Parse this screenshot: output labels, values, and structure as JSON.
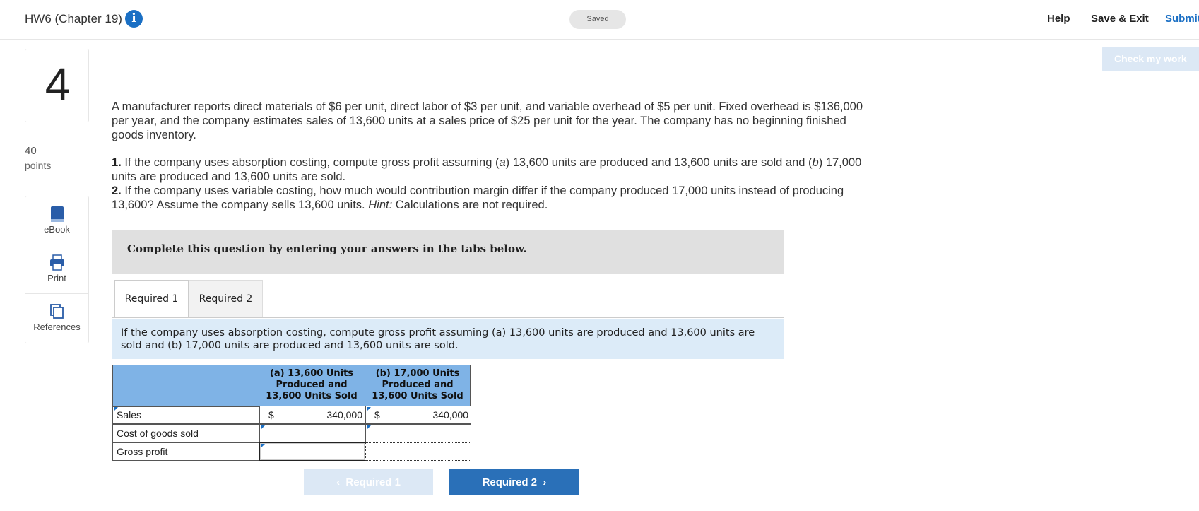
{
  "header": {
    "title": "HW6 (Chapter 19)",
    "status": "Saved",
    "help_label": "Help",
    "save_exit_label": "Save & Exit",
    "submit_label": "Submit"
  },
  "check_work_label": "Check my work",
  "question": {
    "number": "4",
    "points_value": "40",
    "points_label": "points"
  },
  "tools": [
    {
      "label": "eBook",
      "icon": "book-icon"
    },
    {
      "label": "Print",
      "icon": "printer-icon"
    },
    {
      "label": "References",
      "icon": "references-icon"
    }
  ],
  "body": {
    "intro": "A manufacturer reports direct materials of $6 per unit, direct labor of $3 per unit, and variable overhead of $5 per unit. Fixed overhead is $136,000 per year, and the company estimates sales of 13,600 units at a sales price of $25 per unit for the year. The company has no beginning finished goods inventory.",
    "part1_num": "1.",
    "part1_text_a": " If the company uses absorption costing, compute gross profit assuming (",
    "part1_a": "a",
    "part1_text_b": ") 13,600 units are produced and 13,600 units are sold and (",
    "part1_b": "b",
    "part1_text_c": ") 17,000 units are produced and 13,600 units are sold.",
    "part2_num": "2.",
    "part2_text": " If the company uses variable costing, how much would contribution margin differ if the company produced 17,000 units instead of producing 13,600? Assume the company sells 13,600 units. ",
    "hint_label": "Hint:",
    "hint_text": " Calculations are not required.",
    "instructions": "Complete this question by entering your answers in the tabs below."
  },
  "tabs": [
    {
      "label": "Required 1",
      "active": true
    },
    {
      "label": "Required 2",
      "active": false
    }
  ],
  "prompt": "If the company uses absorption costing, compute gross profit assuming (a) 13,600 units are produced and 13,600 units are sold and (b) 17,000 units are produced and 13,600 units are sold.",
  "table": {
    "col_a": "(a) 13,600 Units Produced and 13,600 Units Sold",
    "col_b": "(b) 17,000 Units Produced and 13,600 Units Sold",
    "rows": [
      {
        "label": "Sales",
        "a_cur": "$",
        "a_val": "340,000",
        "b_cur": "$",
        "b_val": "340,000"
      },
      {
        "label": "Cost of goods sold",
        "a_val": "",
        "b_val": ""
      },
      {
        "label": "Gross profit",
        "a_val": "",
        "b_val": ""
      }
    ]
  },
  "nav": {
    "prev_label": "Required 1",
    "next_label": "Required 2"
  }
}
